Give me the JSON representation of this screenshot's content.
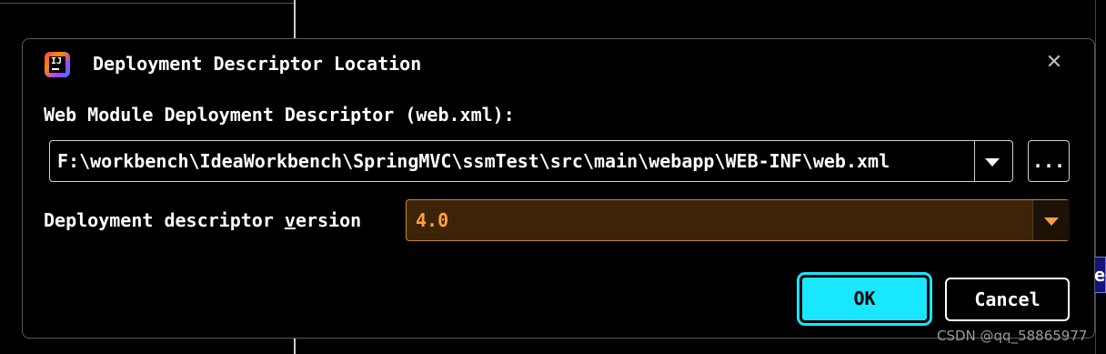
{
  "background": {
    "partial_tab_text": "e"
  },
  "dialog": {
    "title": "Deployment Descriptor Location",
    "app_icon": "intellij-idea-icon",
    "app_icon_text": "IJ",
    "close_icon": "close-icon",
    "close_glyph": "✕"
  },
  "descriptor": {
    "label": "Web Module Deployment Descriptor (web.xml):",
    "path": "F:\\workbench\\IdeaWorkbench\\SpringMVC\\ssmTest\\src\\main\\webapp\\WEB-INF\\web.xml",
    "browse_label": "..."
  },
  "version": {
    "label_prefix": "Deployment descriptor ",
    "label_mnemonic": "v",
    "label_suffix": "ersion",
    "value": "4.0"
  },
  "buttons": {
    "ok": "OK",
    "cancel": "Cancel"
  },
  "watermark": "CSDN @qq_58865977",
  "colors": {
    "ok_background": "#19e6ff",
    "version_text": "#ff9f43",
    "version_background": "#3d2308",
    "version_border": "#c88530"
  }
}
